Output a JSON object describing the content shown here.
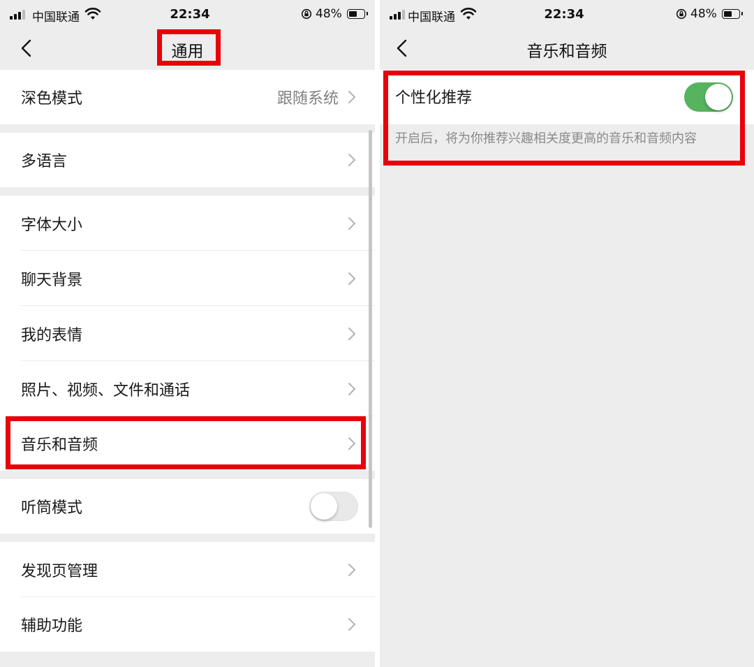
{
  "status_bar": {
    "carrier": "中国联通",
    "time": "22:34",
    "battery": "48%",
    "battery_level": 0.48
  },
  "left_screen": {
    "title": "通用",
    "rows": [
      {
        "label": "深色模式",
        "value": "跟随系统"
      },
      {
        "label": "多语言"
      },
      {
        "label": "字体大小"
      },
      {
        "label": "聊天背景"
      },
      {
        "label": "我的表情"
      },
      {
        "label": "照片、视频、文件和通话"
      },
      {
        "label": "音乐和音频"
      },
      {
        "label": "听筒模式",
        "toggle": false
      },
      {
        "label": "发现页管理"
      },
      {
        "label": "辅助功能"
      }
    ]
  },
  "right_screen": {
    "title": "音乐和音频",
    "option_label": "个性化推荐",
    "option_enabled": true,
    "option_description": "开启后，将为你推荐兴趣相关度更高的音乐和音频内容"
  },
  "colors": {
    "highlight": "#e8000b",
    "toggle_on": "#56b35e",
    "background": "#ededed"
  }
}
